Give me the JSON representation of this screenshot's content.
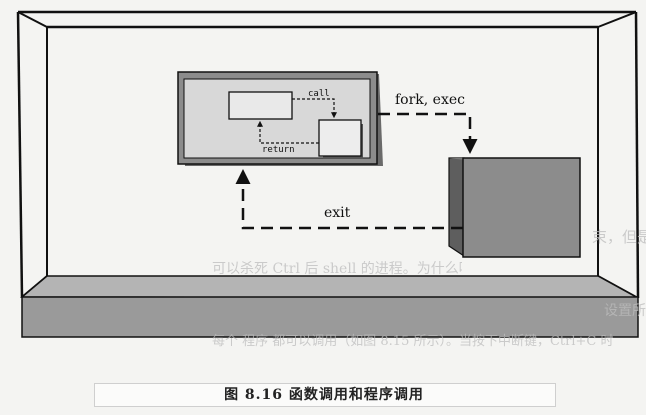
{
  "diagram": {
    "labels": {
      "call": "call",
      "return": "return",
      "fork_exec": "fork, exec",
      "exit": "exit"
    }
  },
  "caption": {
    "text": "图 8.16   函数调用和程序调用"
  },
  "background_text": {
    "right_1": "束，但是 shell 也执行了，按下 Ctrl+C 所生成的 SIGINT 信号",
    "right_2": "可以杀死 Ctrl 后 shell 的进程。为什么呢？",
    "right_3": "设置所有进程的进程",
    "right_4": "每个 程序 都可以调用（如图 8.15 所示）。当按下中断键，Ctrl+C 时"
  },
  "colors": {
    "box_fill": "#8c8c8c",
    "box_side": "#5e5e5e",
    "outline": "#111111",
    "floor": "#9a9a9a",
    "inner_panel": "#d8d8d8"
  }
}
